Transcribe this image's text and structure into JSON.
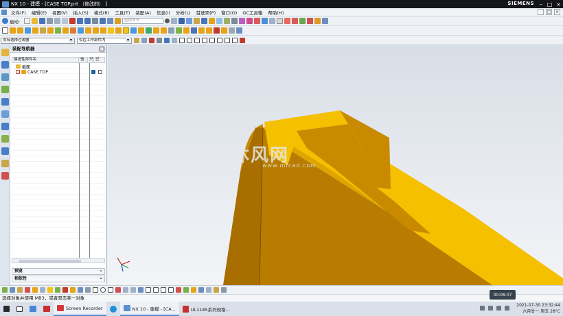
{
  "window": {
    "title": "NX 10 - 建模 - [CASE TOP.prt （修改的） ]",
    "brand": "SIEMENS",
    "controls": [
      "–",
      "□",
      "×"
    ]
  },
  "menu": {
    "items": [
      "文件(F)",
      "编辑(E)",
      "视图(V)",
      "插入(S)",
      "格式(R)",
      "工具(T)",
      "装配(A)",
      "信息(I)",
      "分析(L)",
      "首选项(P)",
      "窗口(O)",
      "GC工具箱",
      "帮助(H)"
    ],
    "right_controls": [
      "–",
      "□",
      "×"
    ]
  },
  "toolbar": {
    "start_label": "启动·",
    "search_placeholder": "查找命令"
  },
  "filter": {
    "selection_filter": "没有选择过滤器",
    "scope": "仅在工作部件内"
  },
  "navigator": {
    "title": "装配导航器",
    "columns": [
      "描述性部件名",
      "信..",
      "只",
      "已"
    ],
    "rows": [
      {
        "label": "截面"
      },
      {
        "label": "CASE TOP"
      }
    ],
    "panes": [
      "预览",
      "相依性"
    ]
  },
  "watermark": {
    "text": "沐风网",
    "sub": "www.mfcad.com"
  },
  "status": {
    "message": "选择对象并使用 MB3，或者双击某一对象"
  },
  "recorder": {
    "time": "00:06:07"
  },
  "taskbar": {
    "items": [
      {
        "label": "Screen Recorder"
      },
      {
        "label": "NX 10 - 建模 - [CA..."
      },
      {
        "label": "UL1185系列规格..."
      }
    ],
    "datetime": "2021-07-30 23:32:44",
    "date_line": "六月廿一 周五 28°C"
  },
  "colors": {
    "part_face": "#f5c000",
    "part_side": "#c98a00",
    "part_dark": "#a86f00",
    "titlebar": "#141518"
  }
}
